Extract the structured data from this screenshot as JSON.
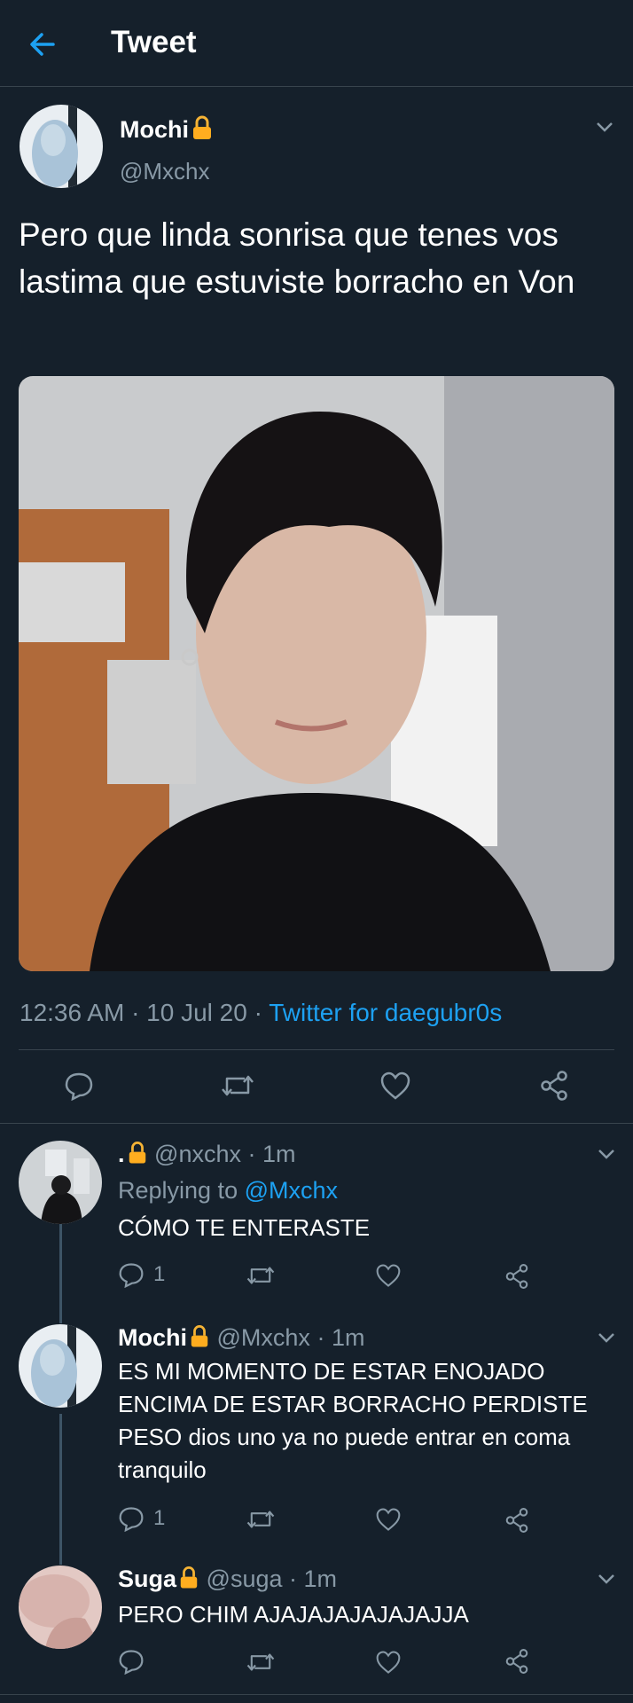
{
  "header": {
    "title": "Tweet"
  },
  "tweet": {
    "name": "Mochi",
    "handle": "@Mxchx",
    "text": "Pero que linda sonrisa que tenes vos lastima que estuviste borracho en Von",
    "time": "12:36 AM · 10 Jul 20 · ",
    "source": "Twitter for daegubr0s"
  },
  "replies": [
    {
      "name": ".",
      "handle": "@nxchx",
      "time": "· 1m",
      "replying_prefix": "Replying to ",
      "replying_to": "@Mxchx",
      "text": "CÓMO TE ENTERASTE",
      "reply_count": "1"
    },
    {
      "name": "Mochi",
      "handle": "@Mxchx",
      "time": "· 1m",
      "text": "ES MI MOMENTO DE ESTAR ENOJADO ENCIMA DE ESTAR BORRACHO PERDISTE PESO dios uno ya no puede entrar en coma tranquilo",
      "reply_count": "1"
    },
    {
      "name": "Suga",
      "handle": "@suga",
      "time": "· 1m",
      "text": "PERO CHIM AJAJAJAJAJAJAJJA"
    }
  ],
  "colors": {
    "background": "#15202b",
    "accent": "#1da1f2",
    "muted": "#8899a6",
    "lock": "#ffad1f"
  }
}
